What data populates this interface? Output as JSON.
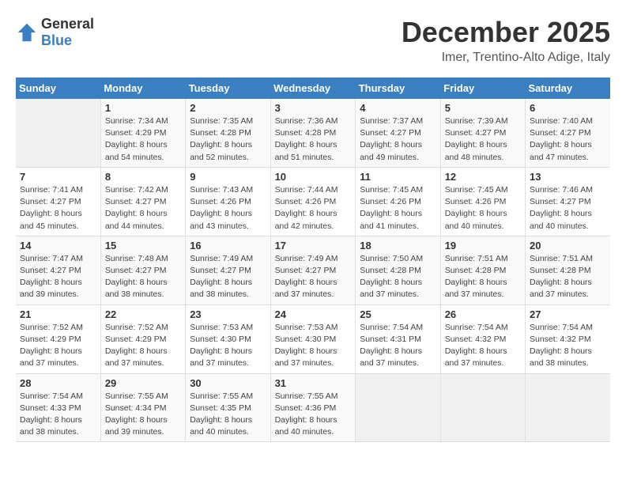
{
  "logo": {
    "text_general": "General",
    "text_blue": "Blue"
  },
  "header": {
    "month_year": "December 2025",
    "location": "Imer, Trentino-Alto Adige, Italy"
  },
  "days_of_week": [
    "Sunday",
    "Monday",
    "Tuesday",
    "Wednesday",
    "Thursday",
    "Friday",
    "Saturday"
  ],
  "weeks": [
    [
      {
        "day": "",
        "info": ""
      },
      {
        "day": "1",
        "info": "Sunrise: 7:34 AM\nSunset: 4:29 PM\nDaylight: 8 hours\nand 54 minutes."
      },
      {
        "day": "2",
        "info": "Sunrise: 7:35 AM\nSunset: 4:28 PM\nDaylight: 8 hours\nand 52 minutes."
      },
      {
        "day": "3",
        "info": "Sunrise: 7:36 AM\nSunset: 4:28 PM\nDaylight: 8 hours\nand 51 minutes."
      },
      {
        "day": "4",
        "info": "Sunrise: 7:37 AM\nSunset: 4:27 PM\nDaylight: 8 hours\nand 49 minutes."
      },
      {
        "day": "5",
        "info": "Sunrise: 7:39 AM\nSunset: 4:27 PM\nDaylight: 8 hours\nand 48 minutes."
      },
      {
        "day": "6",
        "info": "Sunrise: 7:40 AM\nSunset: 4:27 PM\nDaylight: 8 hours\nand 47 minutes."
      }
    ],
    [
      {
        "day": "7",
        "info": "Sunrise: 7:41 AM\nSunset: 4:27 PM\nDaylight: 8 hours\nand 45 minutes."
      },
      {
        "day": "8",
        "info": "Sunrise: 7:42 AM\nSunset: 4:27 PM\nDaylight: 8 hours\nand 44 minutes."
      },
      {
        "day": "9",
        "info": "Sunrise: 7:43 AM\nSunset: 4:26 PM\nDaylight: 8 hours\nand 43 minutes."
      },
      {
        "day": "10",
        "info": "Sunrise: 7:44 AM\nSunset: 4:26 PM\nDaylight: 8 hours\nand 42 minutes."
      },
      {
        "day": "11",
        "info": "Sunrise: 7:45 AM\nSunset: 4:26 PM\nDaylight: 8 hours\nand 41 minutes."
      },
      {
        "day": "12",
        "info": "Sunrise: 7:45 AM\nSunset: 4:26 PM\nDaylight: 8 hours\nand 40 minutes."
      },
      {
        "day": "13",
        "info": "Sunrise: 7:46 AM\nSunset: 4:27 PM\nDaylight: 8 hours\nand 40 minutes."
      }
    ],
    [
      {
        "day": "14",
        "info": "Sunrise: 7:47 AM\nSunset: 4:27 PM\nDaylight: 8 hours\nand 39 minutes."
      },
      {
        "day": "15",
        "info": "Sunrise: 7:48 AM\nSunset: 4:27 PM\nDaylight: 8 hours\nand 38 minutes."
      },
      {
        "day": "16",
        "info": "Sunrise: 7:49 AM\nSunset: 4:27 PM\nDaylight: 8 hours\nand 38 minutes."
      },
      {
        "day": "17",
        "info": "Sunrise: 7:49 AM\nSunset: 4:27 PM\nDaylight: 8 hours\nand 37 minutes."
      },
      {
        "day": "18",
        "info": "Sunrise: 7:50 AM\nSunset: 4:28 PM\nDaylight: 8 hours\nand 37 minutes."
      },
      {
        "day": "19",
        "info": "Sunrise: 7:51 AM\nSunset: 4:28 PM\nDaylight: 8 hours\nand 37 minutes."
      },
      {
        "day": "20",
        "info": "Sunrise: 7:51 AM\nSunset: 4:28 PM\nDaylight: 8 hours\nand 37 minutes."
      }
    ],
    [
      {
        "day": "21",
        "info": "Sunrise: 7:52 AM\nSunset: 4:29 PM\nDaylight: 8 hours\nand 37 minutes."
      },
      {
        "day": "22",
        "info": "Sunrise: 7:52 AM\nSunset: 4:29 PM\nDaylight: 8 hours\nand 37 minutes."
      },
      {
        "day": "23",
        "info": "Sunrise: 7:53 AM\nSunset: 4:30 PM\nDaylight: 8 hours\nand 37 minutes."
      },
      {
        "day": "24",
        "info": "Sunrise: 7:53 AM\nSunset: 4:30 PM\nDaylight: 8 hours\nand 37 minutes."
      },
      {
        "day": "25",
        "info": "Sunrise: 7:54 AM\nSunset: 4:31 PM\nDaylight: 8 hours\nand 37 minutes."
      },
      {
        "day": "26",
        "info": "Sunrise: 7:54 AM\nSunset: 4:32 PM\nDaylight: 8 hours\nand 37 minutes."
      },
      {
        "day": "27",
        "info": "Sunrise: 7:54 AM\nSunset: 4:32 PM\nDaylight: 8 hours\nand 38 minutes."
      }
    ],
    [
      {
        "day": "28",
        "info": "Sunrise: 7:54 AM\nSunset: 4:33 PM\nDaylight: 8 hours\nand 38 minutes."
      },
      {
        "day": "29",
        "info": "Sunrise: 7:55 AM\nSunset: 4:34 PM\nDaylight: 8 hours\nand 39 minutes."
      },
      {
        "day": "30",
        "info": "Sunrise: 7:55 AM\nSunset: 4:35 PM\nDaylight: 8 hours\nand 40 minutes."
      },
      {
        "day": "31",
        "info": "Sunrise: 7:55 AM\nSunset: 4:36 PM\nDaylight: 8 hours\nand 40 minutes."
      },
      {
        "day": "",
        "info": ""
      },
      {
        "day": "",
        "info": ""
      },
      {
        "day": "",
        "info": ""
      }
    ]
  ]
}
